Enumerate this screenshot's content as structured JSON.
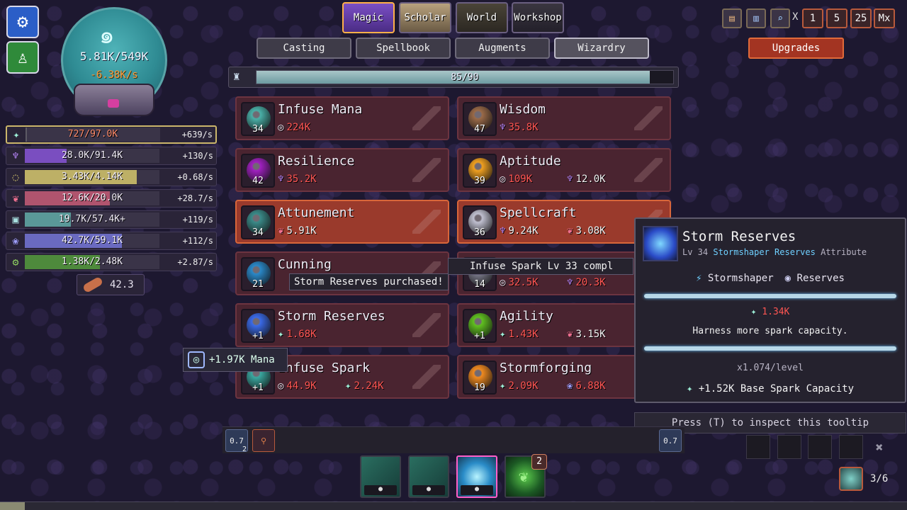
{
  "colors": {
    "mana": "#2f8b93",
    "red_cost": "#ff5552",
    "purchasable": "#9a3a2c",
    "tab_active": "#ffb04a"
  },
  "orb": {
    "value": "5.81K/549K",
    "rate": "-6.38K/s",
    "icon": "swirl-icon"
  },
  "resources": [
    {
      "name": "spark",
      "icon": "spark-icon",
      "text": "727/97.0K",
      "rate": "+639/s",
      "fill": 0.008,
      "color": "#5c5a64",
      "text_color": "#ff8b6a"
    },
    {
      "name": "wisdom",
      "icon": "lotus-icon",
      "text": "28.0K/91.4K",
      "rate": "+130/s",
      "fill": 0.31,
      "color": "#7a4ec0",
      "text_color": "#f2eef8"
    },
    {
      "name": "aptitude",
      "icon": "ring-icon",
      "text": "3.43K/4.14K",
      "rate": "+0.68/s",
      "fill": 0.83,
      "color": "#bdb066",
      "text_color": "#f2eef8"
    },
    {
      "name": "heart",
      "icon": "heart-icon",
      "text": "12.6K/20.0K",
      "rate": "+28.7/s",
      "fill": 0.63,
      "color": "#b0546e",
      "text_color": "#f2eef8"
    },
    {
      "name": "crystal",
      "icon": "cube-icon",
      "text": "19.7K/57.4K+",
      "rate": "+119/s",
      "fill": 0.34,
      "color": "#5a9898",
      "text_color": "#f2eef8"
    },
    {
      "name": "flower",
      "icon": "flower-icon",
      "text": "42.7K/59.1K",
      "rate": "+112/s",
      "fill": 0.72,
      "color": "#6a6ac0",
      "text_color": "#f2eef8"
    },
    {
      "name": "gear",
      "icon": "gear-icon",
      "text": "1.38K/2.48K",
      "rate": "+2.87/s",
      "fill": 0.56,
      "color": "#4e8a3c",
      "text_color": "#f2eef8"
    }
  ],
  "wood": {
    "value": "42.3",
    "icon": "log-icon"
  },
  "tabs": [
    "Magic",
    "Scholar",
    "World",
    "Workshop"
  ],
  "subtabs": [
    "Casting",
    "Spellbook",
    "Augments",
    "Wizardry"
  ],
  "progress": {
    "text": "85/90",
    "value": 85,
    "max": 90
  },
  "cards": [
    {
      "name": "Infuse Mana",
      "level": "34",
      "orb": "#4ab0a8",
      "purchasable": false,
      "costs": [
        {
          "icon": "swirl-icon",
          "glyph": "◎",
          "value": "224K",
          "red": true
        }
      ]
    },
    {
      "name": "Wisdom",
      "level": "47",
      "orb": "#9a6a48",
      "purchasable": false,
      "costs": [
        {
          "icon": "lotus-icon",
          "glyph": "♆",
          "value": "35.8K",
          "red": true
        }
      ]
    },
    {
      "name": "Resilience",
      "level": "42",
      "orb": "#a020c0",
      "purchasable": false,
      "costs": [
        {
          "icon": "lotus-icon",
          "glyph": "♆",
          "value": "35.2K",
          "red": true
        }
      ]
    },
    {
      "name": "Aptitude",
      "level": "39",
      "orb": "#f0a020",
      "purchasable": false,
      "costs": [
        {
          "icon": "swirl-icon",
          "glyph": "◎",
          "value": "109K",
          "red": true
        },
        {
          "icon": "lotus-icon",
          "glyph": "♆",
          "value": "12.0K",
          "red": false
        }
      ]
    },
    {
      "name": "Attunement",
      "level": "34",
      "orb": "#3a8a88",
      "purchasable": true,
      "costs": [
        {
          "icon": "heart-icon",
          "glyph": "❦",
          "value": "5.91K",
          "red": false
        }
      ]
    },
    {
      "name": "Spellcraft",
      "level": "36",
      "orb": "#c0c0d0",
      "purchasable": true,
      "costs": [
        {
          "icon": "lotus-icon",
          "glyph": "♆",
          "value": "9.24K",
          "red": false
        },
        {
          "icon": "heart-icon",
          "glyph": "❦",
          "value": "3.08K",
          "red": false
        }
      ]
    },
    {
      "name": "Cunning",
      "level": "21",
      "orb": "#2a88c8",
      "purchasable": false,
      "costs": []
    },
    {
      "name": "",
      "level": "14",
      "orb": "#7a7a8a",
      "purchasable": false,
      "costs": [
        {
          "icon": "swirl-icon",
          "glyph": "◎",
          "value": "32.5K",
          "red": true
        },
        {
          "icon": "lotus-icon",
          "glyph": "♆",
          "value": "20.3K",
          "red": true
        }
      ]
    },
    {
      "name": "Storm Reserves",
      "level": "+1",
      "orb": "#3a6ae8",
      "purchasable": false,
      "costs": [
        {
          "icon": "spark-icon",
          "glyph": "✦",
          "value": "1.68K",
          "red": true
        }
      ]
    },
    {
      "name": "Agility",
      "level": "+1",
      "orb": "#60c020",
      "purchasable": false,
      "costs": [
        {
          "icon": "spark-icon",
          "glyph": "✦",
          "value": "1.43K",
          "red": true
        },
        {
          "icon": "heart-icon",
          "glyph": "❦",
          "value": "3.15K",
          "red": false
        }
      ]
    },
    {
      "name": "Infuse Spark",
      "level": "+1",
      "orb": "#3aa8a0",
      "purchasable": false,
      "costs": [
        {
          "icon": "swirl-icon",
          "glyph": "◎",
          "value": "44.9K",
          "red": true
        },
        {
          "icon": "spark-icon",
          "glyph": "✦",
          "value": "2.24K",
          "red": true
        }
      ]
    },
    {
      "name": "Stormforging",
      "level": "19",
      "orb": "#f08a20",
      "purchasable": false,
      "costs": [
        {
          "icon": "spark-icon",
          "glyph": "✦",
          "value": "2.09K",
          "red": true
        },
        {
          "icon": "flower-icon",
          "glyph": "❀",
          "value": "6.88K",
          "red": true
        }
      ]
    }
  ],
  "notifications": {
    "purchased": "Storm Reserves purchased!",
    "infuse": "Infuse Spark Lv 33 compl",
    "mana_gain": "+1.97K Mana"
  },
  "tooltip": {
    "title": "Storm Reserves",
    "level": "Lv 34",
    "category": "Stormshaper Reserves",
    "type": "Attribute",
    "tags": [
      "Stormshaper",
      "Reserves"
    ],
    "cost": "1.34K",
    "description": "Harness more spark capacity.",
    "scaling": "x1.074/level",
    "bonus": "+1.52K Base Spark Capacity"
  },
  "inspect_hint": "Press (T) to inspect this tooltip",
  "multipliers": [
    "1",
    "5",
    "25",
    "Mx"
  ],
  "multiplier_x": "X",
  "upgrades_label": "Upgrades",
  "hotbar": {
    "left_slot_value": "0.7",
    "left_slot_count": "2",
    "right_slot_value": "0.7"
  },
  "spell_slots": [
    {
      "badge": ""
    },
    {
      "badge": ""
    },
    {
      "badge": ""
    },
    {
      "badge": "2"
    }
  ],
  "page_indicator": "3/6",
  "xp_progress": 0.027
}
